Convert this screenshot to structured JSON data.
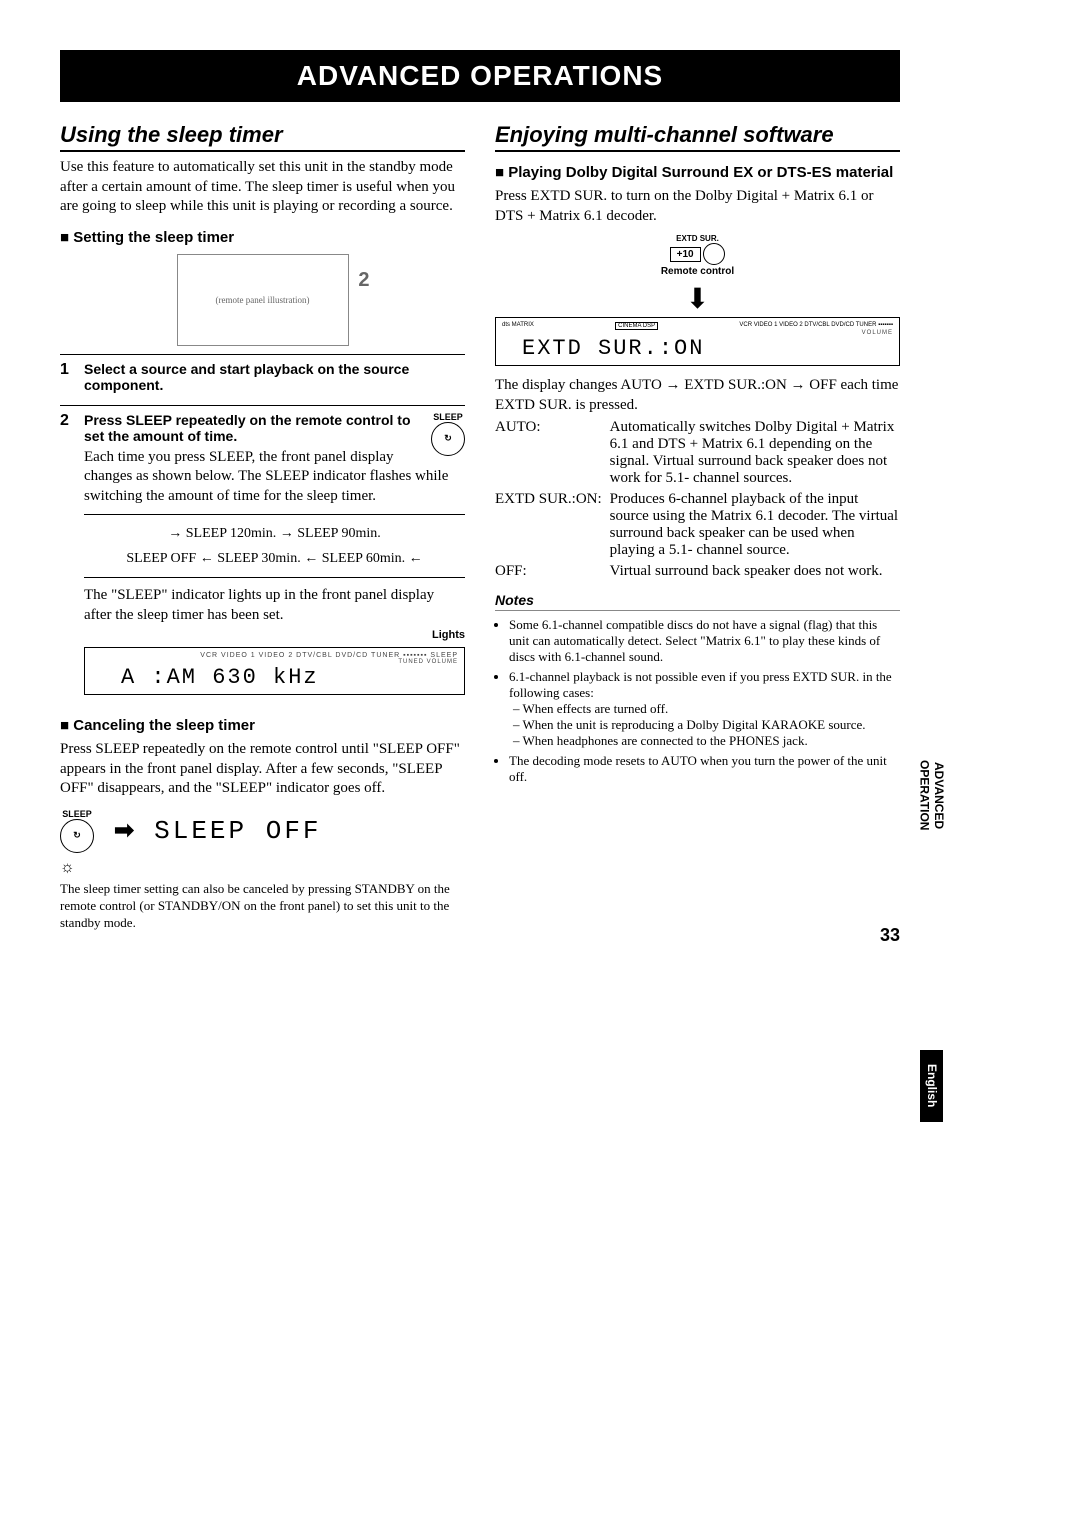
{
  "banner": "ADVANCED OPERATIONS",
  "left": {
    "title": "Using the sleep timer",
    "intro": "Use this feature to automatically set this unit in the standby mode after a certain amount of time. The sleep timer is useful when you are going to sleep while this unit is playing or recording a source.",
    "setting_head": "Setting the sleep timer",
    "diagram_callout": "2",
    "step1_num": "1",
    "step1_bold": "Select a source and start playback on the source component.",
    "step2_num": "2",
    "step2_bold": "Press SLEEP repeatedly on the remote control to set the amount of time.",
    "step2_icon_label": "SLEEP",
    "step2_body": "Each time you press SLEEP, the front panel display changes as shown below. The SLEEP indicator flashes while switching the amount of time for the sleep timer.",
    "cycle_line1": "→  SLEEP  120min.  →  SLEEP  90min.",
    "cycle_line2": "SLEEP OFF ← SLEEP  30min. ← SLEEP  60min. ←",
    "after_cycle": "The \"SLEEP\" indicator lights up in the front panel display after the sleep timer has been set.",
    "lights_label": "Lights",
    "lcd1_top": "VCR  VIDEO 1  VIDEO 2  DTV/CBL  DVD/CD  TUNER  ▪▪▪▪▪▪▪  SLEEP",
    "lcd1_sub": "TUNED   VOLUME",
    "lcd1_main": "A :AM  630 kHz",
    "cancel_head": "Canceling the sleep timer",
    "cancel_body": "Press SLEEP repeatedly on the remote control until \"SLEEP OFF\" appears in the front panel display. After a few seconds, \"SLEEP OFF\" disappears, and the \"SLEEP\" indicator goes off.",
    "sleep_btn_label": "SLEEP",
    "sleep_off_text": "SLEEP OFF",
    "tip_text": "The sleep timer setting can also be canceled by pressing STANDBY on the remote control (or STANDBY/ON on the front panel) to set this unit to the standby mode."
  },
  "right": {
    "title": "Enjoying multi-channel software",
    "playing_head": "Playing Dolby Digital Surround EX or DTS-ES material",
    "playing_body": "Press EXTD SUR. to turn on the Dolby Digital + Matrix 6.1 or DTS + Matrix 6.1 decoder.",
    "remote_top": "EXTD SUR.",
    "remote_btn": "+10",
    "remote_label": "Remote control",
    "lcd_top": "VCR  VIDEO 1  VIDEO 2  DTV/CBL  DVD/CD  TUNER  ▪▪▪▪▪▪▪",
    "lcd_left": "dts MATRIX",
    "lcd_cinema": "CINEMA DSP",
    "lcd_sub": "VOLUME",
    "lcd_main": "EXTD SUR.:ON",
    "cycle_text": "The display changes AUTO → EXTD SUR.:ON → OFF each time EXTD SUR. is pressed.",
    "defs": [
      {
        "k": "AUTO:",
        "v": "Automatically switches Dolby Digital + Matrix 6.1 and DTS + Matrix 6.1 depending on the signal. Virtual surround back speaker does not work for 5.1- channel sources."
      },
      {
        "k": "EXTD SUR.:ON:",
        "v": "Produces 6-channel playback of the input source using the Matrix 6.1 decoder. The virtual surround back speaker can be used when playing a 5.1- channel source."
      },
      {
        "k": "OFF:",
        "v": "Virtual surround back speaker does not work."
      }
    ],
    "notes_head": "Notes",
    "notes": [
      "Some 6.1-channel compatible discs do not have a signal (flag) that this unit can automatically detect. Select \"Matrix 6.1\" to play these kinds of discs with 6.1-channel sound.",
      "6.1-channel playback is not possible even if you press EXTD SUR. in the following cases:",
      "The decoding mode resets to AUTO when you turn the power of the unit off."
    ],
    "subnotes": [
      "– When effects are turned off.",
      "– When the unit is reproducing a Dolby Digital KARAOKE source.",
      "– When headphones are connected to the PHONES jack."
    ]
  },
  "side_tab1_line1": "ADVANCED",
  "side_tab1_line2": "OPERATION",
  "side_tab2": "English",
  "page": "33"
}
